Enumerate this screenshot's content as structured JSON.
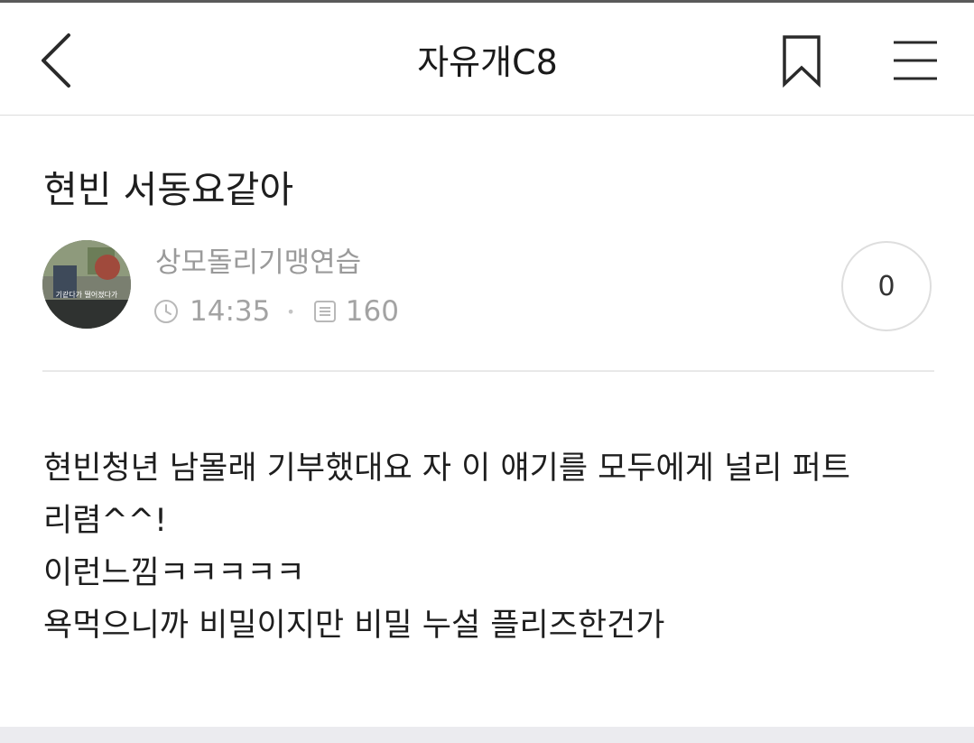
{
  "header": {
    "title": "자유개C8",
    "back_icon": "chevron-left-icon",
    "bookmark_icon": "bookmark-icon",
    "menu_icon": "hamburger-menu-icon"
  },
  "post": {
    "title": "현빈 서동요같아",
    "author": "상모돌리기맹연습",
    "time": "14:35",
    "views": "160",
    "comment_count": "0",
    "avatar_caption": "기같다가 떨어졌다가",
    "body_lines": [
      "현빈청년 남몰래 기부했대요 자 이 얘기를 모두에게 널리 퍼트",
      "리렴^^!",
      "이런느낌ㅋㅋㅋㅋㅋ",
      "욕먹으니까 비밀이지만 비밀 누설 플리즈한건가"
    ]
  },
  "colors": {
    "meta_text": "#a3a3a3",
    "divider": "#e8e8e8",
    "body_text": "#1e1e1e"
  }
}
